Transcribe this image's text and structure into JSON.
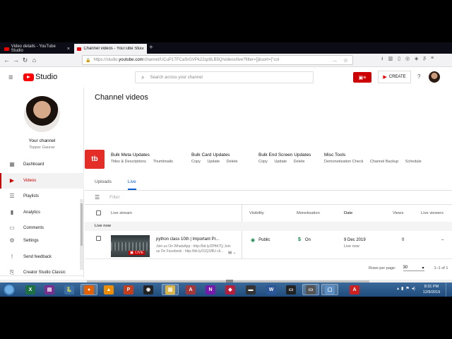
{
  "browser": {
    "tabs": [
      {
        "title": "Video details - YouTube Studio",
        "active": false
      },
      {
        "title": "Channel videos - YouTube Studio",
        "active": true
      }
    ],
    "new_tab_icon": "plus-icon",
    "url_prefix": "https://studio.",
    "url_domain": "youtube.com",
    "url_rest": "/channel/UCuP1TFCaSrGVPk22qz8LB5Q/videos/live?filter=[]&sort={\"col",
    "url_more": "...",
    "bookmark_star": "☆"
  },
  "studio": {
    "logo_text": "Studio",
    "search_placeholder": "Search across your channel",
    "create_label": "CREATE",
    "help_glyph": "?"
  },
  "sidebar": {
    "channel_title": "Your channel",
    "channel_name": "Topper Gaurav",
    "items": [
      {
        "label": "Dashboard",
        "icon": "dashboard-icon",
        "glyph": "▦",
        "active": false
      },
      {
        "label": "Videos",
        "icon": "videos-icon",
        "glyph": "▶",
        "active": true
      },
      {
        "label": "Playlists",
        "icon": "playlists-icon",
        "glyph": "☰",
        "active": false
      },
      {
        "label": "Analytics",
        "icon": "analytics-icon",
        "glyph": "▮",
        "active": false
      },
      {
        "label": "Comments",
        "icon": "comments-icon",
        "glyph": "▭",
        "active": false
      }
    ],
    "bottom_items": [
      {
        "label": "Settings",
        "icon": "gear-icon",
        "glyph": "⚙"
      },
      {
        "label": "Send feedback",
        "icon": "feedback-icon",
        "glyph": "!"
      },
      {
        "label": "Creator Studio Classic",
        "icon": "classic-icon",
        "glyph": "⎘"
      }
    ]
  },
  "main": {
    "page_title": "Channel videos",
    "extension_logo": "tb",
    "bulk_menus": [
      {
        "title": "Bulk Meta Updates",
        "links": [
          "Titles & Descriptions",
          "Thumbnails"
        ]
      },
      {
        "title": "Bulk Card Updates",
        "links": [
          "Copy",
          "Update",
          "Delete"
        ]
      },
      {
        "title": "Bulk End Screen Updates",
        "links": [
          "Copy",
          "Update",
          "Delete"
        ]
      },
      {
        "title": "Misc Tools",
        "links": [
          "Demonetization Check",
          "Channel Backup",
          "Schedule"
        ]
      }
    ],
    "tabs": [
      {
        "label": "Uploads",
        "active": false
      },
      {
        "label": "Live",
        "active": true
      }
    ],
    "filter_placeholder": "Filter",
    "columns": {
      "stream": "Live stream",
      "visibility": "Visibility",
      "monetization": "Monetisation",
      "date": "Date",
      "views": "Views",
      "live_viewers": "Live viewers"
    },
    "section_label": "Live now",
    "rows": [
      {
        "title": "python class 10th | Important Pr...",
        "desc1": "Join us On WhatsApp : http://bit.ly/2Pfth7Q Join",
        "desc2": "us On Facebook : http://bit.ly/31Q1f8U cli...",
        "thumb_badge": "LIVE",
        "visibility": "Public",
        "monetization": "On",
        "date": "9 Dec 2019",
        "status": "Live now",
        "views": "0",
        "live_viewers": "–"
      }
    ],
    "pagination": {
      "rows_label": "Rows per page:",
      "rows_value": "30",
      "range": "1–1 of 1"
    }
  },
  "taskbar": {
    "time": "8:31 PM",
    "date": "12/9/2019",
    "apps": [
      {
        "icon": "excel-icon",
        "glyph": "X",
        "color": "#1d7044"
      },
      {
        "icon": "winrar-icon",
        "glyph": "▤",
        "color": "#7a2f8e"
      },
      {
        "icon": "python-icon",
        "glyph": "🐍",
        "color": "#3b6fa5"
      },
      {
        "icon": "firefox-icon",
        "glyph": "●",
        "color": "#e66000"
      },
      {
        "icon": "vlc-icon",
        "glyph": "▲",
        "color": "#f08c00"
      },
      {
        "icon": "powerpoint-icon",
        "glyph": "P",
        "color": "#c43e1c"
      },
      {
        "icon": "obs-icon",
        "glyph": "◉",
        "color": "#222"
      },
      {
        "icon": "file-explorer-icon",
        "glyph": "▥",
        "color": "#d9b44a"
      },
      {
        "icon": "access-icon",
        "glyph": "A",
        "color": "#a4373a"
      },
      {
        "icon": "onenote-icon",
        "glyph": "N",
        "color": "#7719aa"
      },
      {
        "icon": "app-icon",
        "glyph": "◆",
        "color": "#b81e3c"
      },
      {
        "icon": "media-icon",
        "glyph": "▬",
        "color": "#333"
      },
      {
        "icon": "word-icon",
        "glyph": "W",
        "color": "#2b579a"
      },
      {
        "icon": "terminal-icon",
        "glyph": "▭",
        "color": "#222"
      },
      {
        "icon": "monitor-icon",
        "glyph": "▭",
        "color": "#555"
      },
      {
        "icon": "window-icon",
        "glyph": "▢",
        "color": "#5e8fc4"
      },
      {
        "icon": "pdf-icon",
        "glyph": "A",
        "color": "#d01f1f"
      }
    ]
  }
}
